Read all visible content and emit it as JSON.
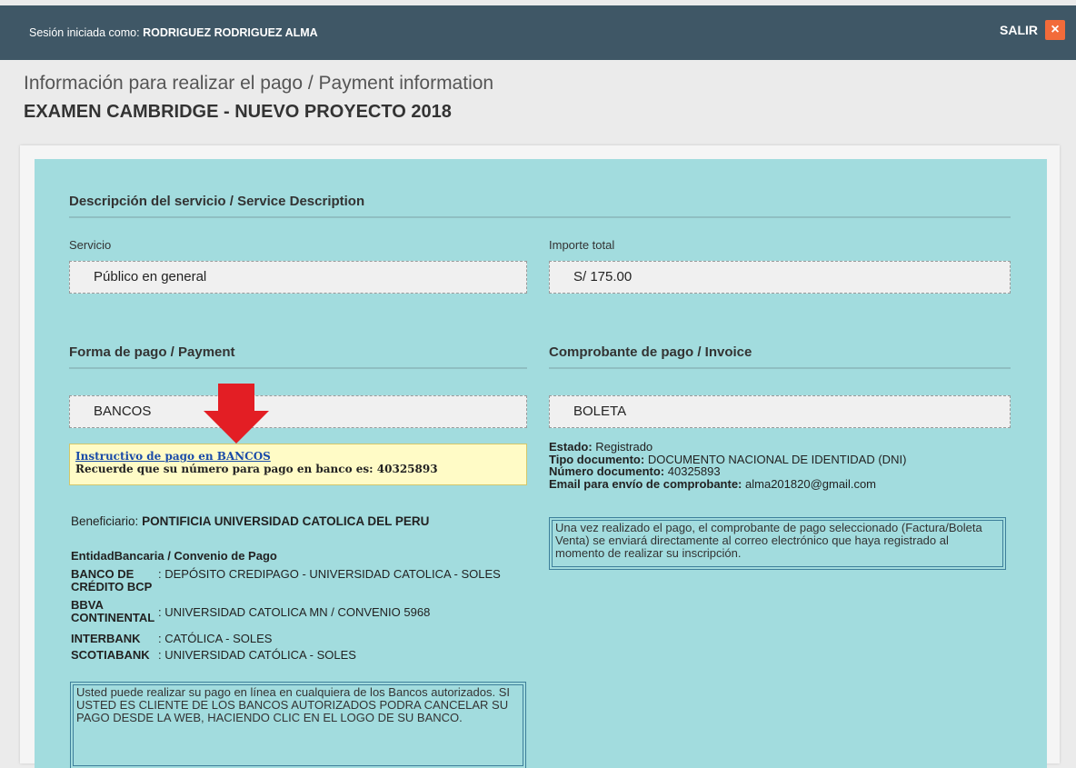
{
  "header": {
    "session_prefix": "Sesión iniciada como:",
    "user_name": "RODRIGUEZ RODRIGUEZ ALMA",
    "logout_label": "SALIR",
    "close_glyph": "×"
  },
  "page": {
    "title": "Información para realizar el pago / Payment information",
    "subtitle": "EXAMEN CAMBRIDGE - NUEVO PROYECTO 2018"
  },
  "service": {
    "section_title": "Descripción del servicio / Service Description",
    "servicio_label": "Servicio",
    "servicio_value": "Público en general",
    "importe_label": "Importe total",
    "importe_value": "S/ 175.00"
  },
  "payment": {
    "section_title": "Forma de pago / Payment",
    "method": "BANCOS",
    "instructions_link": "Instructivo de pago en BANCOS",
    "instructions_note": "Recuerde que su número para pago en banco es: 40325893",
    "beneficiario_label": "Beneficiario:",
    "beneficiario_value": "PONTIFICIA UNIVERSIDAD CATOLICA DEL PERU",
    "bank_table_header": "EntidadBancaria / Convenio de Pago",
    "banks": [
      {
        "name": "BANCO DE CRÉDITO BCP",
        "convenio": ": DEPÓSITO CREDIPAGO - UNIVERSIDAD CATOLICA - SOLES"
      },
      {
        "name": "BBVA CONTINENTAL",
        "convenio": ": UNIVERSIDAD CATOLICA MN / CONVENIO 5968"
      },
      {
        "name": "INTERBANK",
        "convenio": ": CATÓLICA - SOLES"
      },
      {
        "name": "SCOTIABANK",
        "convenio": ": UNIVERSIDAD CATÓLICA - SOLES"
      }
    ],
    "online_note": "Usted puede realizar su pago en línea en cualquiera de los Bancos autorizados. SI USTED ES CLIENTE DE LOS BANCOS AUTORIZADOS PODRA CANCELAR SU PAGO DESDE LA WEB, HACIENDO CLIC EN EL LOGO DE SU BANCO."
  },
  "invoice": {
    "section_title": "Comprobante de pago / Invoice",
    "type": "BOLETA",
    "estado_label": "Estado:",
    "estado_value": "Registrado",
    "tipo_doc_label": "Tipo documento:",
    "tipo_doc_value": "DOCUMENTO NACIONAL DE IDENTIDAD (DNI)",
    "num_doc_label": "Número documento:",
    "num_doc_value": "40325893",
    "email_label": "Email para envío de comprobante:",
    "email_value": "alma201820@gmail.com",
    "note": "Una vez realizado el pago, el comprobante de pago seleccionado (Factura/Boleta Venta) se enviará directamente al correo electrónico que haya registrado al momento de realizar su inscripción."
  },
  "colors": {
    "topbar": "#3f5766",
    "panel": "#a2dcde",
    "accent_close": "#f26b3a",
    "arrow": "#e31e24",
    "instruction_bg": "#fffbc6"
  },
  "icons": {
    "close": "close-icon",
    "arrow": "down-arrow-icon"
  }
}
